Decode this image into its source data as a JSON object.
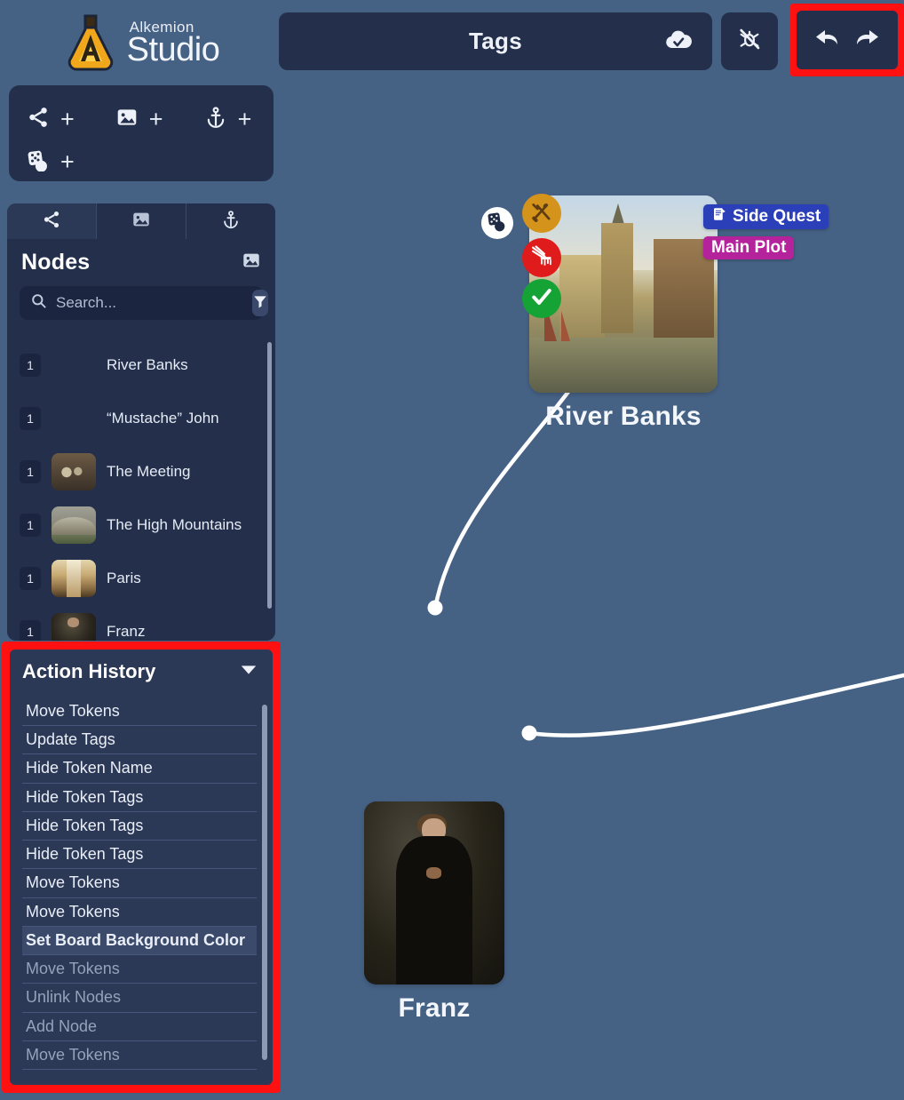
{
  "app": {
    "brand_line1": "Alkemion",
    "brand_line2": "Studio"
  },
  "add_toolbar": {
    "items": [
      {
        "icon": "share-nodes-icon",
        "plus": "+",
        "label": "add-node"
      },
      {
        "icon": "image-icon",
        "plus": "+",
        "label": "add-image"
      },
      {
        "icon": "anchor-icon",
        "plus": "+",
        "label": "add-anchor"
      },
      {
        "icon": "dice-icon",
        "plus": "+",
        "label": "add-dice"
      }
    ]
  },
  "panel_tabs": [
    {
      "name": "tab-nodes",
      "icon": "share-nodes-icon",
      "active": true
    },
    {
      "name": "tab-images",
      "icon": "image-icon",
      "active": false
    },
    {
      "name": "tab-anchors",
      "icon": "anchor-icon",
      "active": false
    }
  ],
  "nodes_panel": {
    "title": "Nodes",
    "header_icon": "image-icon",
    "search": {
      "placeholder": "Search...",
      "value": "",
      "icon": "search-icon",
      "filter_icon": "filter-icon"
    },
    "items": [
      {
        "count": "1",
        "name": "River Banks",
        "thumb": "thumb-river"
      },
      {
        "count": "1",
        "name": "“Mustache” John",
        "thumb": "thumb-portrait"
      },
      {
        "count": "1",
        "name": "The Meeting",
        "thumb": "thumb-meeting"
      },
      {
        "count": "1",
        "name": "The High Mountains",
        "thumb": "thumb-mountains"
      },
      {
        "count": "1",
        "name": "Paris",
        "thumb": "thumb-paris"
      },
      {
        "count": "1",
        "name": "Franz",
        "thumb": "thumb-franz"
      }
    ]
  },
  "action_history": {
    "title": "Action History",
    "collapse_icon": "chevron-down-icon",
    "highlight_color": "#ff1111",
    "items": [
      {
        "label": "Move Tokens",
        "state": "past"
      },
      {
        "label": "Update Tags",
        "state": "past"
      },
      {
        "label": "Hide Token Name",
        "state": "past"
      },
      {
        "label": "Hide Token Tags",
        "state": "past"
      },
      {
        "label": "Hide Token Tags",
        "state": "past"
      },
      {
        "label": "Hide Token Tags",
        "state": "past"
      },
      {
        "label": "Move Tokens",
        "state": "past"
      },
      {
        "label": "Move Tokens",
        "state": "past"
      },
      {
        "label": "Set Board Background Color",
        "state": "current"
      },
      {
        "label": "Move Tokens",
        "state": "future"
      },
      {
        "label": "Unlink Nodes",
        "state": "future"
      },
      {
        "label": "Add Node",
        "state": "future"
      },
      {
        "label": "Move Tokens",
        "state": "future"
      }
    ]
  },
  "topbar": {
    "board_title": "Tags",
    "saved_icon": "cloud-check-icon",
    "nobug_icon": "no-bug-icon",
    "undo_icon": "undo-arrow-icon",
    "redo_icon": "redo-arrow-icon",
    "highlight_color": "#ff1111"
  },
  "canvas": {
    "background": "#456184",
    "tokens": [
      {
        "name": "River Banks",
        "art": "painting-river",
        "badges": [
          {
            "name": "dice-badge",
            "color": "#ffffff",
            "glyph": "dice"
          },
          {
            "name": "tools-badge",
            "color": "#d4931b",
            "glyph": "tools"
          },
          {
            "name": "bloody-dagger-badge",
            "color": "#e01b1b",
            "glyph": "dagger"
          },
          {
            "name": "check-badge",
            "color": "#16a335",
            "glyph": "check"
          }
        ],
        "tags": [
          {
            "label": "Side Quest",
            "color": "#2a3fb8",
            "icon": "scroll-quill-icon"
          },
          {
            "label": "Main Plot",
            "color": "#b4229c",
            "icon": ""
          }
        ]
      },
      {
        "name": "Franz",
        "art": "painting-portrait",
        "badges": [],
        "tags": []
      }
    ]
  }
}
